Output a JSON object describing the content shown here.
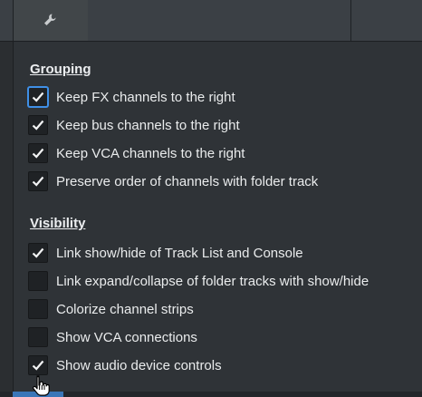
{
  "sections": [
    {
      "title": "Grouping",
      "items": [
        {
          "label": "Keep FX channels to the right",
          "checked": true,
          "focused": true
        },
        {
          "label": "Keep bus channels to the right",
          "checked": true,
          "focused": false
        },
        {
          "label": "Keep VCA channels to the right",
          "checked": true,
          "focused": false
        },
        {
          "label": "Preserve order of channels with folder track",
          "checked": true,
          "focused": false
        }
      ]
    },
    {
      "title": "Visibility",
      "items": [
        {
          "label": "Link show/hide of Track List and Console",
          "checked": true,
          "focused": false
        },
        {
          "label": "Link expand/collapse of folder tracks with show/hide",
          "checked": false,
          "focused": false
        },
        {
          "label": "Colorize channel strips",
          "checked": false,
          "focused": false
        },
        {
          "label": "Show VCA connections",
          "checked": false,
          "focused": false
        },
        {
          "label": "Show audio device controls",
          "checked": true,
          "focused": false
        }
      ]
    }
  ],
  "icons": {
    "settings_tab": "wrench-icon",
    "cursor": "hand-pointer-icon"
  },
  "colors": {
    "background": "#2f3337",
    "focus_ring": "#3f8fe6",
    "accent_tab": "#3a76b8"
  }
}
